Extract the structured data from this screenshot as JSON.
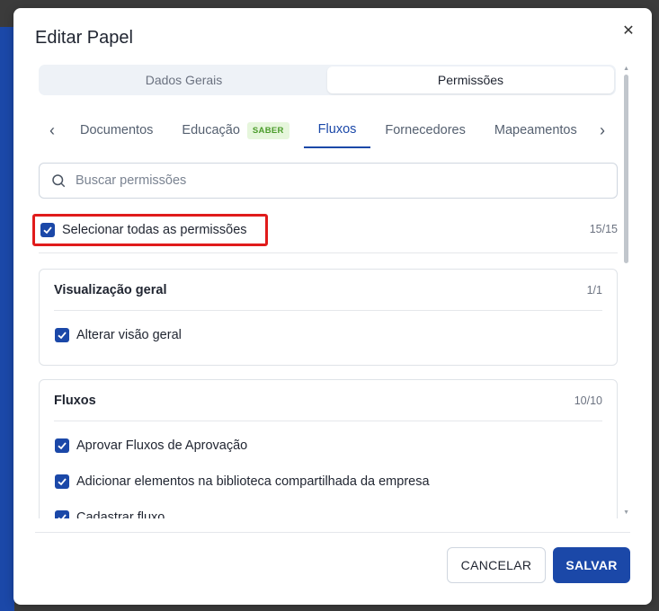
{
  "modal": {
    "title": "Editar Papel",
    "close_icon": "close-icon"
  },
  "segment": {
    "items": [
      {
        "label": "Dados Gerais",
        "active": false
      },
      {
        "label": "Permissões",
        "active": true
      }
    ]
  },
  "tabs": {
    "items": [
      {
        "label": "Documentos",
        "active": false
      },
      {
        "label": "Educação",
        "active": false,
        "badge": "SABER"
      },
      {
        "label": "Fluxos",
        "active": true
      },
      {
        "label": "Fornecedores",
        "active": false
      },
      {
        "label": "Mapeamentos",
        "active": false
      }
    ]
  },
  "search": {
    "placeholder": "Buscar permissões",
    "value": ""
  },
  "select_all": {
    "label": "Selecionar todas as permissões",
    "checked": true,
    "count": "15/15"
  },
  "groups": [
    {
      "title": "Visualização geral",
      "count": "1/1",
      "permissions": [
        {
          "label": "Alterar visão geral",
          "checked": true
        }
      ]
    },
    {
      "title": "Fluxos",
      "count": "10/10",
      "permissions": [
        {
          "label": "Aprovar Fluxos de Aprovação",
          "checked": true
        },
        {
          "label": "Adicionar elementos na biblioteca compartilhada da empresa",
          "checked": true
        },
        {
          "label": "Cadastrar fluxo",
          "checked": true
        }
      ]
    }
  ],
  "footer": {
    "cancel_label": "CANCELAR",
    "save_label": "SALVAR"
  },
  "colors": {
    "primary": "#1b48a8",
    "highlight": "#e01b1b",
    "badge_bg": "#e6f6dc",
    "badge_text": "#4a9b2a"
  }
}
